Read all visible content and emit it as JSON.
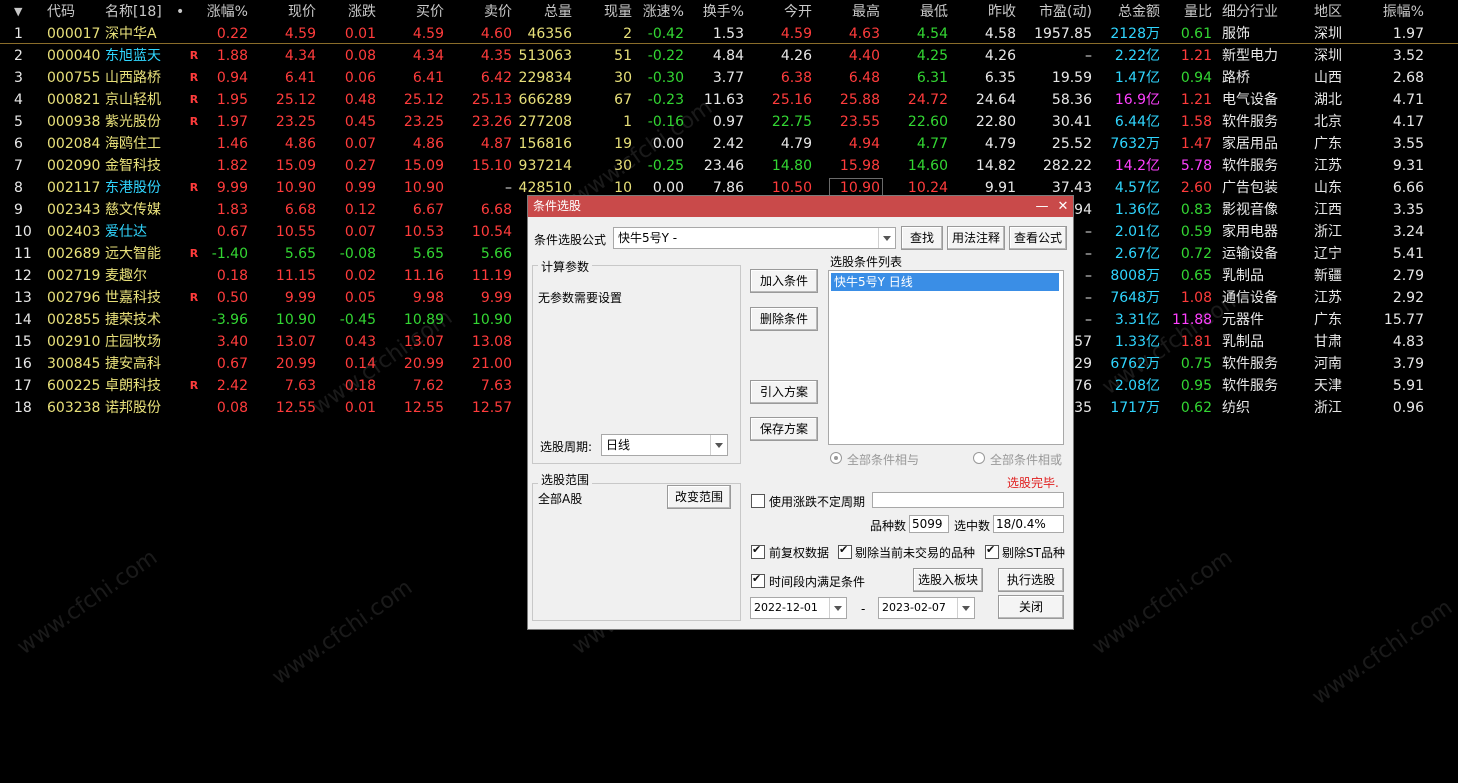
{
  "header": {
    "sort_icon": "sort-down-triangle",
    "columns": [
      "代码",
      "名称[18]",
      "•",
      "涨幅%",
      "现价",
      "涨跌",
      "买价",
      "卖价",
      "总量",
      "现量",
      "涨速%",
      "换手%",
      "今开",
      "最高",
      "最低",
      "昨收",
      "市盈(动)",
      "总金额",
      "量比",
      "细分行业",
      "地区",
      "振幅%"
    ]
  },
  "colors": {
    "red": "#ff3c3c",
    "green": "#33d633",
    "yellow": "#e8e07a",
    "white": "#e8e8e8",
    "cyan": "#30d6ff",
    "magenta": "#ff40ff",
    "dialog_title": "#c94a4a",
    "list_selected": "#3a8ee6"
  },
  "rows": [
    {
      "idx": "1",
      "code": "000017",
      "name": "深中华A",
      "r": "",
      "chg_pct": "0.22",
      "price": "4.59",
      "chg": "0.01",
      "bid": "4.59",
      "ask": "4.60",
      "vol": "46356",
      "cur_vol": "2",
      "speed": "-0.42",
      "turn": "1.53",
      "open": "4.59",
      "high": "4.63",
      "low": "4.54",
      "prev": "4.58",
      "pe": "1957.85",
      "amount": "2128万",
      "vr": "0.61",
      "industry": "服饰",
      "region": "深圳",
      "amp": "1.97"
    },
    {
      "idx": "2",
      "code": "000040",
      "name": "东旭蓝天",
      "r": "R",
      "chg_pct": "1.88",
      "price": "4.34",
      "chg": "0.08",
      "bid": "4.34",
      "ask": "4.35",
      "vol": "513063",
      "cur_vol": "51",
      "speed": "-0.22",
      "turn": "4.84",
      "open": "4.26",
      "high": "4.40",
      "low": "4.25",
      "prev": "4.26",
      "pe": "–",
      "amount": "2.22亿",
      "vr": "1.21",
      "industry": "新型电力",
      "region": "深圳",
      "amp": "3.52"
    },
    {
      "idx": "3",
      "code": "000755",
      "name": "山西路桥",
      "r": "R",
      "chg_pct": "0.94",
      "price": "6.41",
      "chg": "0.06",
      "bid": "6.41",
      "ask": "6.42",
      "vol": "229834",
      "cur_vol": "30",
      "speed": "-0.30",
      "turn": "3.77",
      "open": "6.38",
      "high": "6.48",
      "low": "6.31",
      "prev": "6.35",
      "pe": "19.59",
      "amount": "1.47亿",
      "vr": "0.94",
      "industry": "路桥",
      "region": "山西",
      "amp": "2.68"
    },
    {
      "idx": "4",
      "code": "000821",
      "name": "京山轻机",
      "r": "R",
      "chg_pct": "1.95",
      "price": "25.12",
      "chg": "0.48",
      "bid": "25.12",
      "ask": "25.13",
      "vol": "666289",
      "cur_vol": "67",
      "speed": "-0.23",
      "turn": "11.63",
      "open": "25.16",
      "high": "25.88",
      "low": "24.72",
      "prev": "24.64",
      "pe": "58.36",
      "amount": "16.9亿",
      "vr": "1.21",
      "industry": "电气设备",
      "region": "湖北",
      "amp": "4.71"
    },
    {
      "idx": "5",
      "code": "000938",
      "name": "紫光股份",
      "r": "R",
      "chg_pct": "1.97",
      "price": "23.25",
      "chg": "0.45",
      "bid": "23.25",
      "ask": "23.26",
      "vol": "277208",
      "cur_vol": "1",
      "speed": "-0.16",
      "turn": "0.97",
      "open": "22.75",
      "high": "23.55",
      "low": "22.60",
      "prev": "22.80",
      "pe": "30.41",
      "amount": "6.44亿",
      "vr": "1.58",
      "industry": "软件服务",
      "region": "北京",
      "amp": "4.17"
    },
    {
      "idx": "6",
      "code": "002084",
      "name": "海鸥住工",
      "r": "",
      "chg_pct": "1.46",
      "price": "4.86",
      "chg": "0.07",
      "bid": "4.86",
      "ask": "4.87",
      "vol": "156816",
      "cur_vol": "19",
      "speed": "0.00",
      "turn": "2.42",
      "open": "4.79",
      "high": "4.94",
      "low": "4.77",
      "prev": "4.79",
      "pe": "25.52",
      "amount": "7632万",
      "vr": "1.47",
      "industry": "家居用品",
      "region": "广东",
      "amp": "3.55"
    },
    {
      "idx": "7",
      "code": "002090",
      "name": "金智科技",
      "r": "",
      "chg_pct": "1.82",
      "price": "15.09",
      "chg": "0.27",
      "bid": "15.09",
      "ask": "15.10",
      "vol": "937214",
      "cur_vol": "30",
      "speed": "-0.25",
      "turn": "23.46",
      "open": "14.80",
      "high": "15.98",
      "low": "14.60",
      "prev": "14.82",
      "pe": "282.22",
      "amount": "14.2亿",
      "vr": "5.78",
      "industry": "软件服务",
      "region": "江苏",
      "amp": "9.31"
    },
    {
      "idx": "8",
      "code": "002117",
      "name": "东港股份",
      "r": "R",
      "chg_pct": "9.99",
      "price": "10.90",
      "chg": "0.99",
      "bid": "10.90",
      "ask": "–",
      "vol": "428510",
      "cur_vol": "10",
      "speed": "0.00",
      "turn": "7.86",
      "open": "10.50",
      "high": "10.90",
      "low": "10.24",
      "prev": "9.91",
      "pe": "37.43",
      "amount": "4.57亿",
      "vr": "2.60",
      "industry": "广告包装",
      "region": "山东",
      "amp": "6.66"
    },
    {
      "idx": "9",
      "code": "002343",
      "name": "慈文传媒",
      "r": "",
      "chg_pct": "1.83",
      "price": "6.68",
      "chg": "0.12",
      "bid": "6.67",
      "ask": "6.68",
      "vol": "",
      "cur_vol": "",
      "speed": "",
      "turn": "",
      "open": "",
      "high": "",
      "low": "",
      "prev": "",
      "pe": ".94",
      "amount": "1.36亿",
      "vr": "0.83",
      "industry": "影视音像",
      "region": "江西",
      "amp": "3.35"
    },
    {
      "idx": "10",
      "code": "002403",
      "name": "爱仕达",
      "r": "",
      "chg_pct": "0.67",
      "price": "10.55",
      "chg": "0.07",
      "bid": "10.53",
      "ask": "10.54",
      "vol": "",
      "cur_vol": "",
      "speed": "",
      "turn": "",
      "open": "",
      "high": "",
      "low": "",
      "prev": "",
      "pe": "–",
      "amount": "2.01亿",
      "vr": "0.59",
      "industry": "家用电器",
      "region": "浙江",
      "amp": "3.24"
    },
    {
      "idx": "11",
      "code": "002689",
      "name": "远大智能",
      "r": "R",
      "chg_pct": "-1.40",
      "price": "5.65",
      "chg": "-0.08",
      "bid": "5.65",
      "ask": "5.66",
      "vol": "",
      "cur_vol": "",
      "speed": "",
      "turn": "",
      "open": "",
      "high": "",
      "low": "",
      "prev": "",
      "pe": "–",
      "amount": "2.67亿",
      "vr": "0.72",
      "industry": "运输设备",
      "region": "辽宁",
      "amp": "5.41"
    },
    {
      "idx": "12",
      "code": "002719",
      "name": "麦趣尔",
      "r": "",
      "chg_pct": "0.18",
      "price": "11.15",
      "chg": "0.02",
      "bid": "11.16",
      "ask": "11.19",
      "vol": "",
      "cur_vol": "",
      "speed": "",
      "turn": "",
      "open": "",
      "high": "",
      "low": "",
      "prev": "",
      "pe": "–",
      "amount": "8008万",
      "vr": "0.65",
      "industry": "乳制品",
      "region": "新疆",
      "amp": "2.79"
    },
    {
      "idx": "13",
      "code": "002796",
      "name": "世嘉科技",
      "r": "R",
      "chg_pct": "0.50",
      "price": "9.99",
      "chg": "0.05",
      "bid": "9.98",
      "ask": "9.99",
      "vol": "",
      "cur_vol": "",
      "speed": "",
      "turn": "",
      "open": "",
      "high": "",
      "low": "",
      "prev": "",
      "pe": "–",
      "amount": "7648万",
      "vr": "1.08",
      "industry": "通信设备",
      "region": "江苏",
      "amp": "2.92"
    },
    {
      "idx": "14",
      "code": "002855",
      "name": "捷荣技术",
      "r": "",
      "chg_pct": "-3.96",
      "price": "10.90",
      "chg": "-0.45",
      "bid": "10.89",
      "ask": "10.90",
      "vol": "",
      "cur_vol": "",
      "speed": "",
      "turn": "",
      "open": "",
      "high": "",
      "low": "",
      "prev": "",
      "pe": "–",
      "amount": "3.31亿",
      "vr": "11.88",
      "industry": "元器件",
      "region": "广东",
      "amp": "15.77"
    },
    {
      "idx": "15",
      "code": "002910",
      "name": "庄园牧场",
      "r": "",
      "chg_pct": "3.40",
      "price": "13.07",
      "chg": "0.43",
      "bid": "13.07",
      "ask": "13.08",
      "vol": "",
      "cur_vol": "",
      "speed": "",
      "turn": "",
      "open": "",
      "high": "",
      "low": "",
      "prev": "",
      "pe": ".57",
      "amount": "1.33亿",
      "vr": "1.81",
      "industry": "乳制品",
      "region": "甘肃",
      "amp": "4.83"
    },
    {
      "idx": "16",
      "code": "300845",
      "name": "捷安高科",
      "r": "",
      "chg_pct": "0.67",
      "price": "20.99",
      "chg": "0.14",
      "bid": "20.99",
      "ask": "21.00",
      "vol": "",
      "cur_vol": "",
      "speed": "",
      "turn": "",
      "open": "",
      "high": "",
      "low": "",
      "prev": "",
      "pe": ".29",
      "amount": "6762万",
      "vr": "0.75",
      "industry": "软件服务",
      "region": "河南",
      "amp": "3.79"
    },
    {
      "idx": "17",
      "code": "600225",
      "name": "卓朗科技",
      "r": "R",
      "chg_pct": "2.42",
      "price": "7.63",
      "chg": "0.18",
      "bid": "7.62",
      "ask": "7.63",
      "vol": "",
      "cur_vol": "",
      "speed": "",
      "turn": "",
      "open": "",
      "high": "",
      "low": "",
      "prev": "",
      "pe": ".76",
      "amount": "2.08亿",
      "vr": "0.95",
      "industry": "软件服务",
      "region": "天津",
      "amp": "5.91"
    },
    {
      "idx": "18",
      "code": "603238",
      "name": "诺邦股份",
      "r": "",
      "chg_pct": "0.08",
      "price": "12.55",
      "chg": "0.01",
      "bid": "12.55",
      "ask": "12.57",
      "vol": "",
      "cur_vol": "",
      "speed": "",
      "turn": "",
      "open": "",
      "high": "",
      "low": "",
      "prev": "",
      "pe": ".35",
      "amount": "1717万",
      "vr": "0.62",
      "industry": "纺织",
      "region": "浙江",
      "amp": "0.96"
    }
  ],
  "dialog": {
    "title": "条件选股",
    "minimize_icon": "minimize-icon",
    "close_icon": "close-icon",
    "formula_label": "条件选股公式",
    "formula_value": "快牛5号Y      -",
    "btn_find": "查找",
    "btn_usage": "用法注释",
    "btn_view_formula": "查看公式",
    "calc_params_label": "计算参数",
    "no_params_text": "无参数需要设置",
    "period_label": "选股周期:",
    "period_value": "日线",
    "btn_add_condition": "加入条件",
    "btn_delete_condition": "删除条件",
    "btn_import_plan": "引入方案",
    "btn_save_plan": "保存方案",
    "condition_list_label": "选股条件列表",
    "condition_items": [
      "快牛5号Y  日线"
    ],
    "radio_all_and": "全部条件相与",
    "radio_all_or": "全部条件相或",
    "status_text": "选股完毕.",
    "range_label": "选股范围",
    "range_value": "全部A股",
    "btn_change_range": "改变范围",
    "use_variable_period": "使用涨跌不定周期",
    "count_label": "品种数",
    "count_value": "5099",
    "selected_label": "选中数",
    "selected_value": "18/0.4%",
    "chk_forward_adjust": "前复权数据",
    "chk_remove_untraded": "剔除当前未交易的品种",
    "chk_remove_st": "剔除ST品种",
    "chk_time_range": "时间段内满足条件",
    "btn_to_block": "选股入板块",
    "btn_execute": "执行选股",
    "btn_close": "关闭",
    "date_from": "2022-12-01",
    "date_sep": "-",
    "date_to": "2023-02-07"
  },
  "watermark": "www.cfchi.com"
}
